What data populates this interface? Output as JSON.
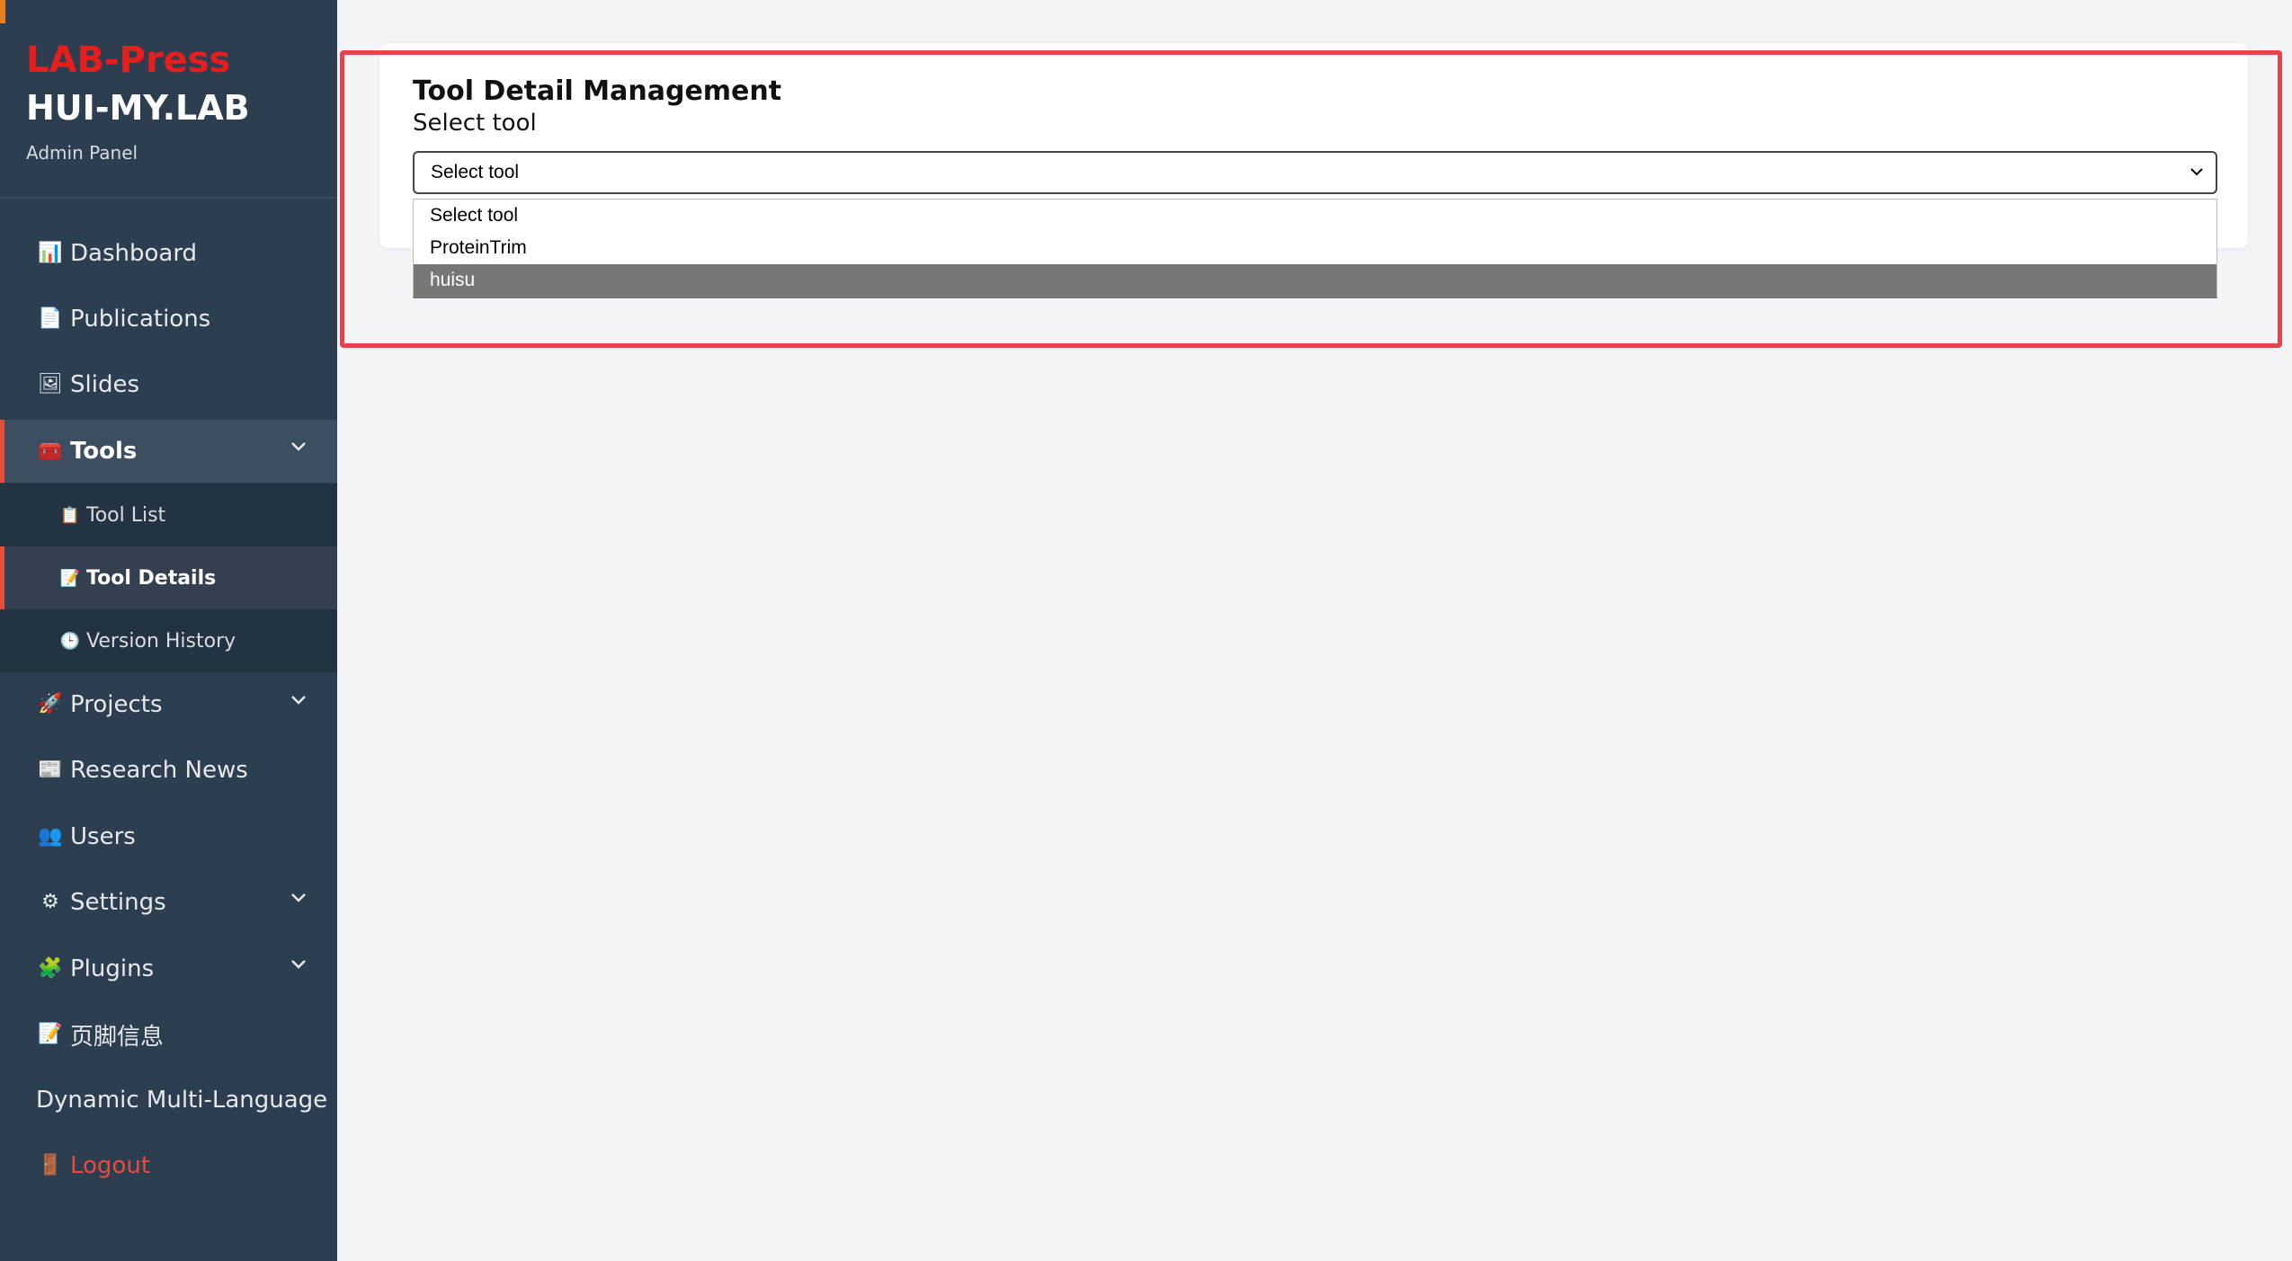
{
  "sidebar": {
    "brand_name": "LAB-Press",
    "brand_lab": "HUI-MY.LAB",
    "brand_sub": "Admin Panel",
    "items": {
      "dashboard": {
        "icon": "📊",
        "label": "Dashboard"
      },
      "publications": {
        "icon": "📄",
        "label": "Publications"
      },
      "slides": {
        "icon": "🖼",
        "label": "Slides"
      },
      "tools": {
        "icon": "🧰",
        "label": "Tools"
      },
      "tool_list": {
        "icon": "📋",
        "label": "Tool List"
      },
      "tool_details": {
        "icon": "📝",
        "label": "Tool Details"
      },
      "version_history": {
        "icon": "🕒",
        "label": "Version History"
      },
      "projects": {
        "icon": "🚀",
        "label": "Projects"
      },
      "research_news": {
        "icon": "📰",
        "label": "Research News"
      },
      "users": {
        "icon": "👥",
        "label": "Users"
      },
      "settings": {
        "icon": "⚙",
        "label": "Settings"
      },
      "plugins": {
        "icon": "🧩",
        "label": "Plugins"
      },
      "footer_info": {
        "icon": "📝",
        "label": "页脚信息"
      },
      "multilang": {
        "label": "Dynamic Multi-Language"
      },
      "logout": {
        "icon": "🚪",
        "label": "Logout"
      }
    }
  },
  "main": {
    "title": "Tool Detail Management",
    "select_label": "Select tool",
    "select_value": "Select tool",
    "options": [
      "Select tool",
      "ProteinTrim",
      "huisu"
    ],
    "highlighted_option": "huisu"
  },
  "colors": {
    "sidebar_bg": "#2c3e50",
    "brand_red": "#e61e1e",
    "active_accent": "#e74c3c",
    "highlight_border": "#e8434b",
    "page_bg": "#f3f4f8"
  }
}
